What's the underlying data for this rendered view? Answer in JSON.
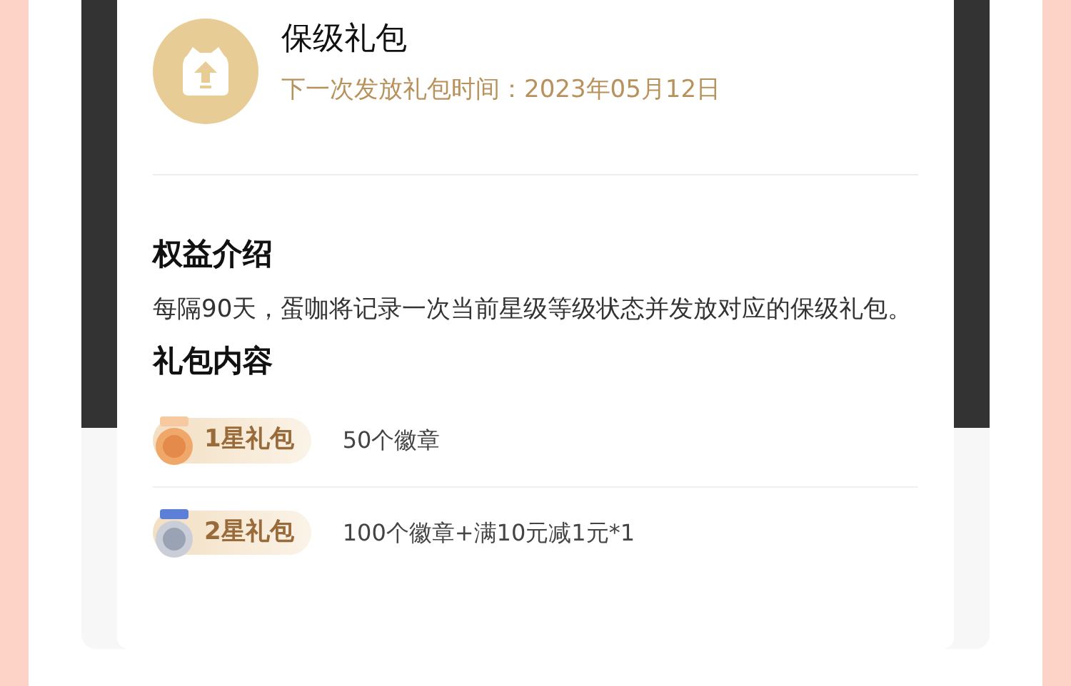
{
  "header": {
    "title": "保级礼包",
    "subtitle": "下一次发放礼包时间：2023年05月12日"
  },
  "intro": {
    "heading": "权益介绍",
    "text": "每隔90天，蛋咖将记录一次当前星级等级状态并发放对应的保级礼包。"
  },
  "contents": {
    "heading": "礼包内容",
    "items": [
      {
        "kind": "bronze",
        "label": "1星礼包",
        "description": "50个徽章"
      },
      {
        "kind": "silver",
        "label": "2星礼包",
        "description": "100个徽章+满10元减1元*1"
      }
    ]
  }
}
